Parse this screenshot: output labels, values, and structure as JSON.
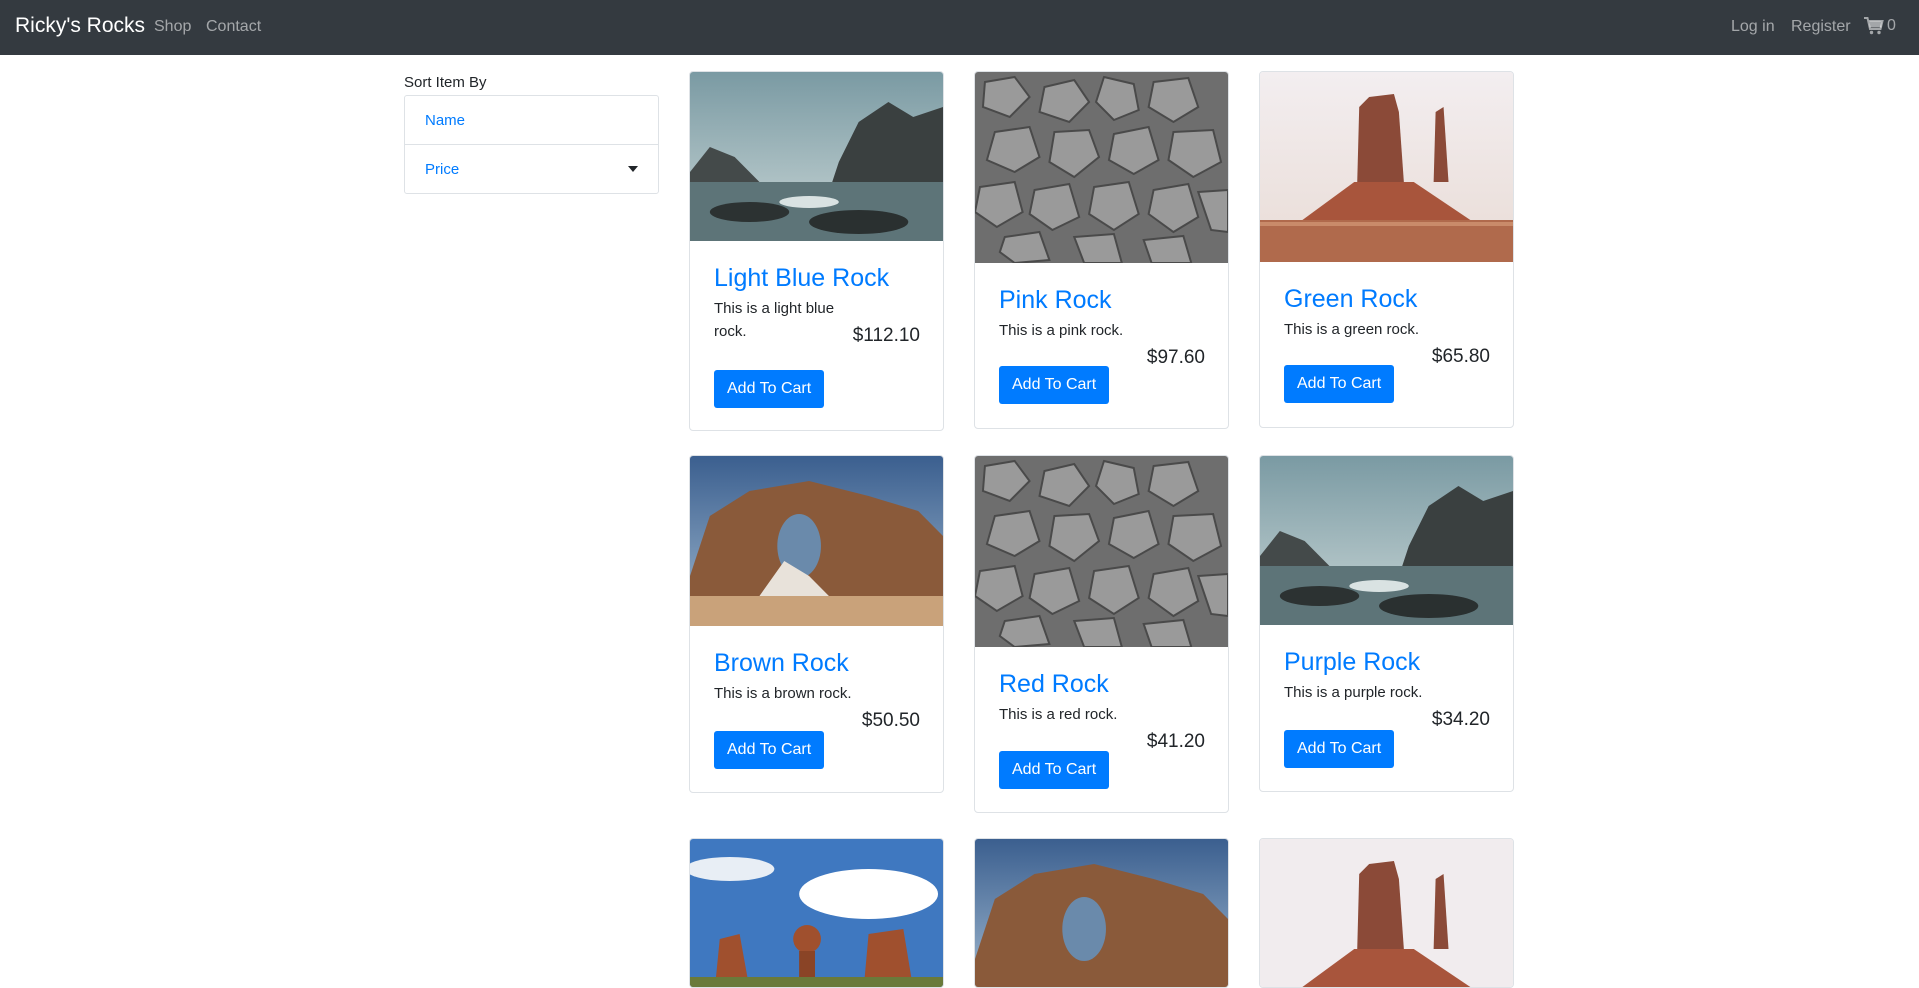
{
  "nav": {
    "brand": "Ricky's Rocks",
    "links": [
      "Shop",
      "Contact"
    ],
    "right_links": [
      "Log in",
      "Register"
    ],
    "cart_count": "0",
    "cart_icon": "shopping-cart-icon"
  },
  "sort": {
    "label": "Sort Item By",
    "options": [
      "Name",
      "Price"
    ]
  },
  "products": [
    {
      "name": "Light Blue Rock",
      "description": "This is a light blue rock.",
      "price": "$112.10",
      "button": "Add To Cart"
    },
    {
      "name": "Pink Rock",
      "description": "This is a pink rock.",
      "price": "$97.60",
      "button": "Add To Cart"
    },
    {
      "name": "Green Rock",
      "description": "This is a green rock.",
      "price": "$65.80",
      "button": "Add To Cart"
    },
    {
      "name": "Brown Rock",
      "description": "This is a brown rock.",
      "price": "$50.50",
      "button": "Add To Cart"
    },
    {
      "name": "Red Rock",
      "description": "This is a red rock.",
      "price": "$41.20",
      "button": "Add To Cart"
    },
    {
      "name": "Purple Rock",
      "description": "This is a purple rock.",
      "price": "$34.20",
      "button": "Add To Cart"
    }
  ],
  "colors": {
    "navbar": "#343a40",
    "link": "#007bff",
    "button": "#007bff"
  }
}
